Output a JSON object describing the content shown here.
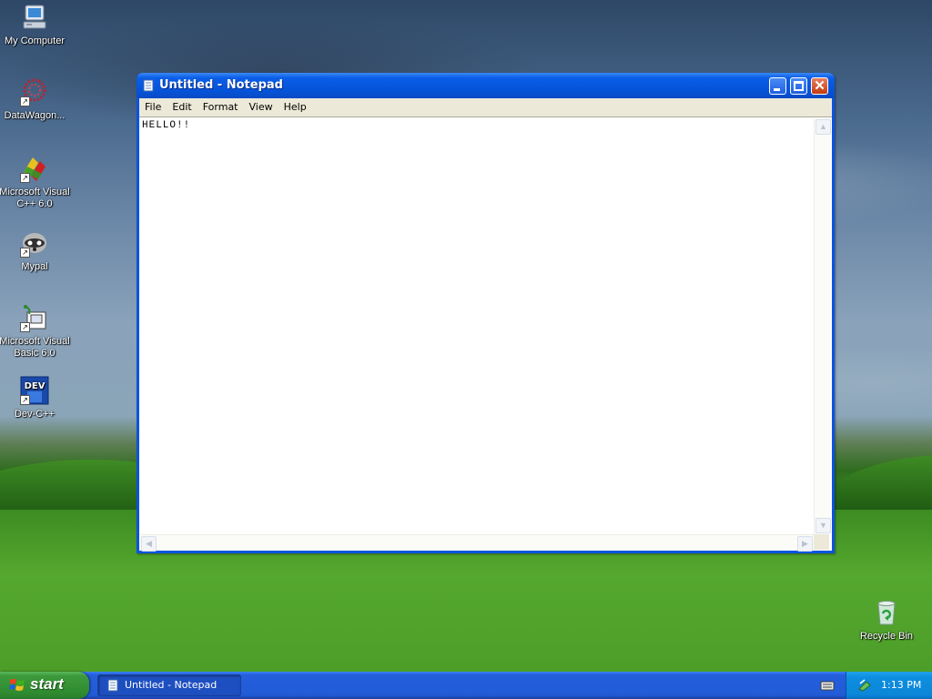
{
  "desktop": {
    "icons": [
      {
        "label": "My Computer"
      },
      {
        "label": "DataWagon..."
      },
      {
        "label": "Microsoft Visual C++ 6.0"
      },
      {
        "label": "Mypal"
      },
      {
        "label": "Microsoft Visual Basic 6.0"
      },
      {
        "label": "Dev-C++"
      },
      {
        "label": "Recycle Bin"
      }
    ]
  },
  "window": {
    "title": "Untitled - Notepad",
    "menu": [
      "File",
      "Edit",
      "Format",
      "View",
      "Help"
    ],
    "content": "HELLO!!"
  },
  "taskbar": {
    "start_label": "start",
    "task_label": "Untitled - Notepad",
    "clock": "1:13 PM"
  }
}
